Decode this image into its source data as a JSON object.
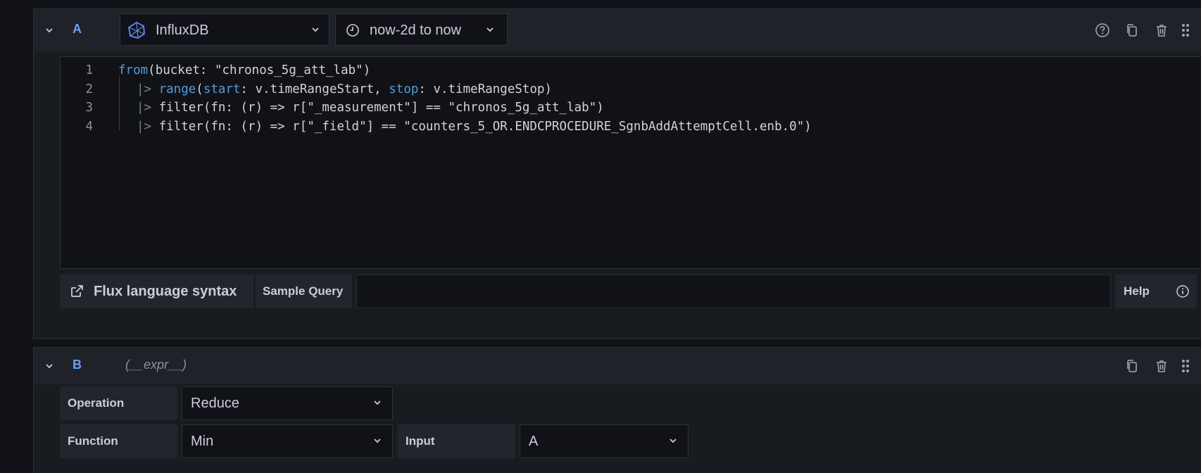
{
  "queries": {
    "a": {
      "name": "A",
      "datasource": "InfluxDB",
      "time_range": "now-2d to now",
      "editor": {
        "lines": [
          {
            "num": "1",
            "pipe": "",
            "parts": [
              {
                "k": "kw",
                "t": "from"
              },
              {
                "k": "",
                "t": "(bucket: \"chronos_5g_att_lab\")"
              }
            ]
          },
          {
            "num": "2",
            "pipe": "|> ",
            "parts": [
              {
                "k": "kw",
                "t": "range"
              },
              {
                "k": "",
                "t": "("
              },
              {
                "k": "kw",
                "t": "start"
              },
              {
                "k": "",
                "t": ": v.timeRangeStart, "
              },
              {
                "k": "kw",
                "t": "stop"
              },
              {
                "k": "",
                "t": ": v.timeRangeStop)"
              }
            ]
          },
          {
            "num": "3",
            "pipe": "|> ",
            "parts": [
              {
                "k": "",
                "t": "filter(fn: (r) => r[\"_measurement\"] == \"chronos_5g_att_lab\")"
              }
            ]
          },
          {
            "num": "4",
            "pipe": "|> ",
            "parts": [
              {
                "k": "",
                "t": "filter(fn: (r) => r[\"_field\"] == \"counters_5_OR.ENDCPROCEDURE_SgnbAddAttemptCell.enb.0\")"
              }
            ]
          }
        ]
      },
      "toolbar": {
        "flux_syntax_label": "Flux language syntax",
        "sample_query_label": "Sample Query",
        "help_label": "Help"
      }
    },
    "b": {
      "name": "B",
      "type_hint": "(__expr__)",
      "operation_label": "Operation",
      "operation_value": "Reduce",
      "function_label": "Function",
      "function_value": "Min",
      "input_label": "Input",
      "input_value": "A"
    }
  },
  "colors": {
    "background": "#111217",
    "panel": "#181b1f",
    "header": "#1f2228",
    "query_name": "#6e9fff",
    "keyword": "#569cd6"
  },
  "icons": {
    "collapse": "chevron-down-icon",
    "datasource": "influxdb-logo-icon",
    "time": "clock-icon",
    "help": "question-circle-icon",
    "duplicate": "copy-icon",
    "delete": "trash-icon",
    "drag": "drag-handle-icon",
    "external": "external-link-icon",
    "info": "info-circle-icon"
  }
}
